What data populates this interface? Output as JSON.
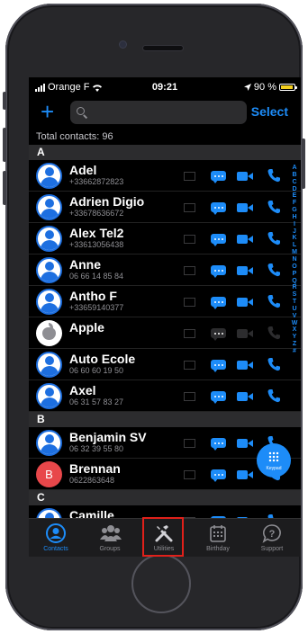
{
  "status": {
    "carrier": "Orange F",
    "time": "09:21",
    "battery": "90 %",
    "battery_level": 0.9
  },
  "toolbar": {
    "add": "+",
    "search_placeholder": "",
    "select": "Select"
  },
  "total": "Total contacts: 96",
  "sections": [
    {
      "letter": "A",
      "contacts": [
        {
          "name": "Adel",
          "phone": "+33662872823"
        },
        {
          "name": "Adrien Digio",
          "phone": "+33678636672"
        },
        {
          "name": "Alex Tel2",
          "phone": "+33613056438"
        },
        {
          "name": "Anne",
          "phone": "06 66 14 85 84"
        },
        {
          "name": "Antho F",
          "phone": "+33659140377"
        },
        {
          "name": "Apple",
          "phone": ""
        },
        {
          "name": "Auto Ecole",
          "phone": "06 60 60 19 50"
        },
        {
          "name": "Axel",
          "phone": "06 31 57 83 27"
        }
      ]
    },
    {
      "letter": "B",
      "contacts": [
        {
          "name": "Benjamin SV",
          "phone": "06 32 39 55 80"
        },
        {
          "name": "Brennan",
          "phone": "0622863648",
          "initial": "B"
        }
      ]
    },
    {
      "letter": "C",
      "contacts": [
        {
          "name": "Camille",
          "phone": ""
        }
      ]
    }
  ],
  "index_letters": [
    "A",
    "B",
    "C",
    "D",
    "E",
    "F",
    "G",
    "H",
    "I",
    "J",
    "K",
    "L",
    "M",
    "N",
    "O",
    "P",
    "Q",
    "R",
    "S",
    "T",
    "U",
    "V",
    "W",
    "X",
    "Y",
    "Z",
    "#"
  ],
  "keypad_label": "Keypad",
  "tabs": [
    {
      "label": "Contacts",
      "icon": "person-circle-icon"
    },
    {
      "label": "Groups",
      "icon": "group-icon"
    },
    {
      "label": "Utilities",
      "icon": "tools-icon"
    },
    {
      "label": "Birthday",
      "icon": "calendar-icon"
    },
    {
      "label": "Support",
      "icon": "question-bubble-icon"
    }
  ],
  "colors": {
    "accent": "#1d8cf8",
    "highlight": "#e0201a",
    "avatar_b": "#e8474a"
  }
}
